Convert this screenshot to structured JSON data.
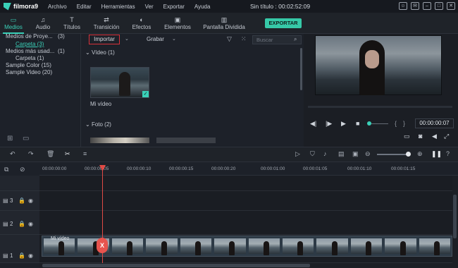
{
  "app": {
    "logo": "filmora9",
    "menus": [
      "Archivo",
      "Editar",
      "Herramientas",
      "Ver",
      "Exportar",
      "Ayuda"
    ],
    "title": "Sin título : 00:02:52:09"
  },
  "tabs": [
    {
      "label": "Medios",
      "icon": "folder-icon",
      "glyph": "▭"
    },
    {
      "label": "Audio",
      "icon": "music-icon",
      "glyph": "♫"
    },
    {
      "label": "Títulos",
      "icon": "title-icon",
      "glyph": "T"
    },
    {
      "label": "Transición",
      "icon": "transition-icon",
      "glyph": "⇄"
    },
    {
      "label": "Efectos",
      "icon": "effects-icon",
      "glyph": "◐"
    },
    {
      "label": "Elementos",
      "icon": "image-icon",
      "glyph": "▣"
    },
    {
      "label": "Pantalla Dividida",
      "icon": "split-screen-icon",
      "glyph": "▥"
    }
  ],
  "export_label": "EXPORTAR",
  "tree": {
    "items": [
      {
        "label": "Medios de Proye...",
        "count": "(3)"
      },
      {
        "label": "Carpeta (3)",
        "count": ""
      },
      {
        "label": "Medios más usad...",
        "count": "(1)"
      },
      {
        "label": "Carpeta (1)",
        "count": ""
      },
      {
        "label": "Sample Color (15)",
        "count": ""
      },
      {
        "label": "Sample Video (20)",
        "count": ""
      }
    ]
  },
  "library": {
    "import_label": "Importar",
    "record_label": "Grabar",
    "search_placeholder": "Buscar",
    "video_section": "Vídeo (1)",
    "video_name": "Mi vídeo",
    "photo_section": "Foto (2)"
  },
  "preview": {
    "timecode": "00:00:00:07"
  },
  "timeline": {
    "ruler": [
      "00:00:00:00",
      "00:00:00:05",
      "00:00:00:10",
      "00:00:00:15",
      "00:00:00:20",
      "00:00:01:00",
      "00:00:01:05",
      "00:00:01:10",
      "00:00:01:15"
    ],
    "tracks": [
      "3",
      "2",
      "1"
    ],
    "clip_label": "Mi vídeo",
    "split_mark": "X"
  }
}
